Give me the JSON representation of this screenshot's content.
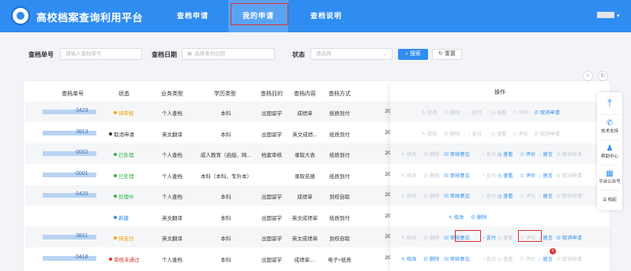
{
  "header": {
    "brand": "高校档案查询利用平台",
    "nav": [
      "查档申请",
      "我的申请",
      "查档说明"
    ],
    "active_nav": "我的申请",
    "avatar_caret": "▾"
  },
  "filters": {
    "no_label": "查档单号",
    "no_placeholder": "请输入查档单号",
    "date_label": "查档日期",
    "date_placeholder": "选择查档日期",
    "status_label": "状态",
    "status_placeholder": "请选择",
    "search_btn": "搜索",
    "reset_btn": "重置"
  },
  "table": {
    "columns": [
      "查档单号",
      "状态",
      "业务类型",
      "学历类型",
      "查档目的",
      "查档内容",
      "查档方式",
      "操作"
    ],
    "truncated_col": "20",
    "rows": [
      {
        "id_suffix": "3423",
        "status": "待审核",
        "status_color": "#f59f00",
        "business": "个人查档",
        "edu": "本科",
        "purpose": "出国留学",
        "content": "成绩单",
        "method": "纸质到付",
        "ops": [
          {
            "t": "✎ 修改",
            "a": false
          },
          {
            "t": "⊘ 删除",
            "a": false
          },
          {
            "t": "◔ 支付",
            "a": false
          },
          {
            "t": "◷ 查看",
            "a": false
          },
          {
            "t": "☆ 评价",
            "a": false
          },
          {
            "t": "⊘ 取消申请",
            "a": true
          }
        ]
      },
      {
        "id_suffix": "3813",
        "status": "取消申请",
        "status_color": "#333333",
        "business": "英文翻译",
        "edu": "本科",
        "purpose": "出国留学",
        "content": "英文成绩...",
        "method": "纸质到付",
        "ops": [
          {
            "t": "✎ 修改",
            "a": false
          },
          {
            "t": "⊘ 删除",
            "a": false
          },
          {
            "t": "◔ 支付",
            "a": false
          },
          {
            "t": "◷ 查看",
            "a": false
          },
          {
            "t": "☆ 评价",
            "a": false
          },
          {
            "t": "⊘ 取消申请",
            "a": false
          }
        ]
      },
      {
        "id_suffix": "0002",
        "status": "已处理",
        "status_color": "#2fb344",
        "business": "个人查档",
        "edu": "成人教育（函授、网...",
        "purpose": "档案审核",
        "content": "录取大表",
        "method": "纸质到付",
        "ops": [
          {
            "t": "✎ 修改",
            "a": false
          },
          {
            "t": "⊘ 删除",
            "a": false
          },
          {
            "t": "▤ 审核意见",
            "a": true
          },
          {
            "t": "◔ 支付",
            "a": false
          },
          {
            "t": "◷ 查看",
            "a": true
          },
          {
            "t": "☆ 评价",
            "a": true
          },
          {
            "t": "◌ 留言",
            "a": true
          },
          {
            "t": "⊘ 取消申请",
            "a": false
          }
        ]
      },
      {
        "id_suffix": "0001",
        "status": "已处理",
        "status_color": "#2fb344",
        "business": "个人查档",
        "edu": "本科（本科、专升本）",
        "purpose": "",
        "content": "录取名册",
        "method": "纸质到付",
        "ops": [
          {
            "t": "✎ 修改",
            "a": false
          },
          {
            "t": "⊘ 删除",
            "a": false
          },
          {
            "t": "▤ 审核意见",
            "a": true
          },
          {
            "t": "◔ 支付",
            "a": false
          },
          {
            "t": "◷ 查看",
            "a": true
          },
          {
            "t": "☆ 评价",
            "a": true
          },
          {
            "t": "◌ 留言",
            "a": true
          },
          {
            "t": "⊘ 取消申请",
            "a": false
          }
        ]
      },
      {
        "id_suffix": "0420",
        "status": "处理中",
        "status_color": "#2fb344",
        "business": "个人查档",
        "edu": "本科",
        "purpose": "出国留学",
        "content": "成绩单",
        "method": "到校自取",
        "ops": [
          {
            "t": "✎ 修改",
            "a": false
          },
          {
            "t": "⊘ 删除",
            "a": false
          },
          {
            "t": "▤ 审核意见",
            "a": true
          },
          {
            "t": "◔ 支付",
            "a": false
          },
          {
            "t": "◷ 查看",
            "a": true
          },
          {
            "t": "☆ 评价",
            "a": false
          },
          {
            "t": "◌ 留言",
            "a": true
          },
          {
            "t": "⊘ 取消申请",
            "a": false
          }
        ]
      },
      {
        "id_suffix": "",
        "status": "新建",
        "status_color": "#2f8cf0",
        "business": "英文翻译",
        "edu": "本科",
        "purpose": "出国留学",
        "content": "英文成绩单",
        "method": "纸质到付",
        "ops": [
          {
            "t": "✎ 修改",
            "a": true
          },
          {
            "t": "⊘ 删除",
            "a": true
          }
        ]
      },
      {
        "id_suffix": "3811",
        "status": "待支付",
        "status_color": "#f59f00",
        "business": "英文翻译",
        "edu": "本科",
        "purpose": "出国留学",
        "content": "英文成绩单",
        "method": "到校自取",
        "ops": [
          {
            "t": "✎ 修改",
            "a": false
          },
          {
            "t": "⊘ 删除",
            "a": false
          },
          {
            "t": "▤ 审核意见",
            "a": true
          },
          {
            "t": "◔ 支付",
            "a": true
          },
          {
            "t": "◷ 查看",
            "a": false
          },
          {
            "t": "☆ 评价",
            "a": false
          },
          {
            "t": "◌ 留言",
            "a": true
          },
          {
            "t": "⊘ 取消申请",
            "a": true
          }
        ]
      },
      {
        "id_suffix": "0418",
        "status": "审核未通过",
        "status_color": "#e03131",
        "business": "个人查档",
        "edu": "本科",
        "purpose": "出国留学",
        "content": "成绩单,...",
        "method": "电子+纸质",
        "ops": [
          {
            "t": "✎ 修改",
            "a": true
          },
          {
            "t": "⊘ 删除",
            "a": true
          },
          {
            "t": "▤ 审核意见",
            "a": true
          },
          {
            "t": "◔ 支付",
            "a": false
          },
          {
            "t": "◷ 查看",
            "a": false
          },
          {
            "t": "☆ 评价",
            "a": false
          },
          {
            "t": "◌ 留言",
            "a": true
          },
          {
            "t": "⊘ 取消申请",
            "a": false
          }
        ],
        "badge": "6"
      }
    ]
  },
  "float_panel": {
    "top_icon": "⤒",
    "items": [
      {
        "icon": "✆",
        "label": "技术支持"
      },
      {
        "icon": "♟",
        "label": "帮助中心"
      },
      {
        "icon": "▦",
        "label": "平台公众号"
      }
    ],
    "collapse": "☰ 收起"
  },
  "tools": {
    "search_icon": "⌕",
    "refresh_icon": "↻"
  }
}
